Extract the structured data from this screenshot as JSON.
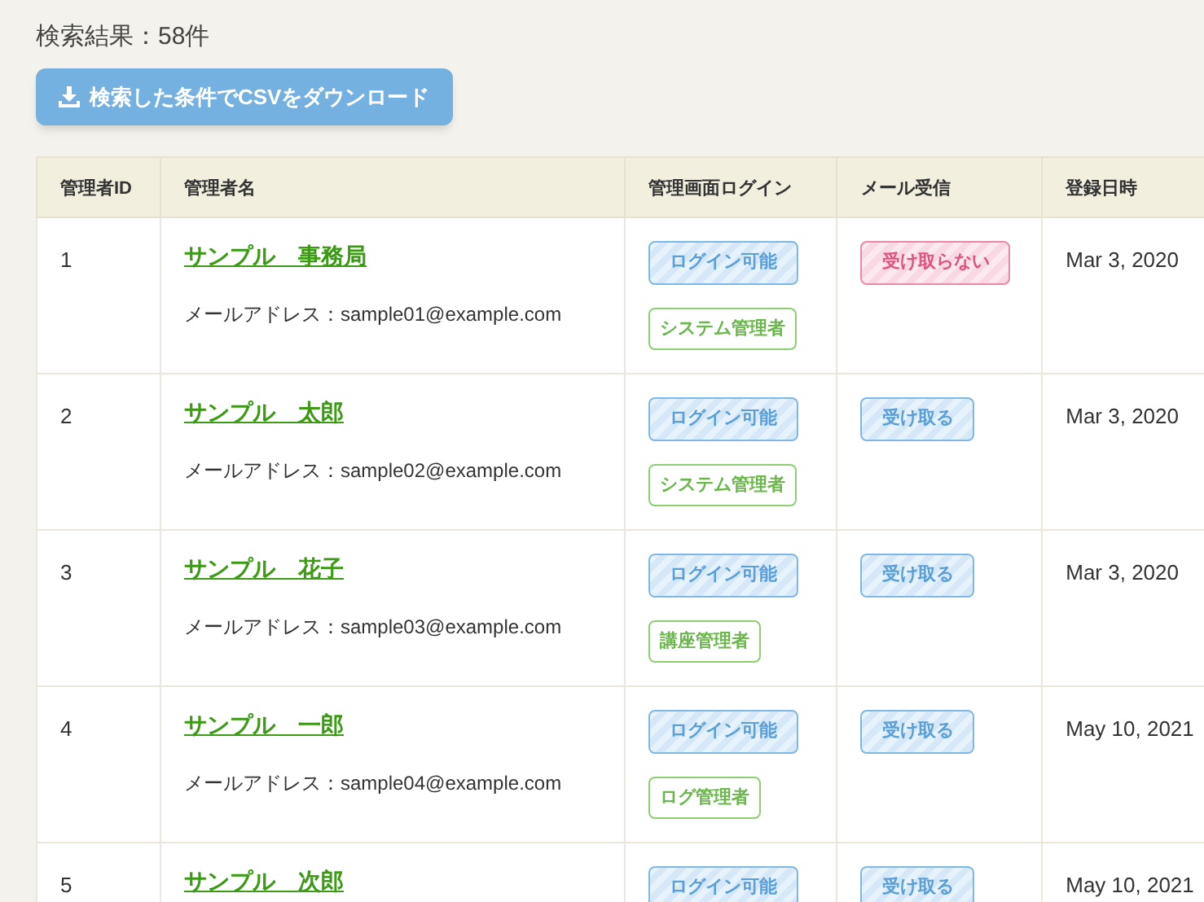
{
  "result_count": "検索結果：58件",
  "download_button": "検索した条件でCSVをダウンロード",
  "table": {
    "columns": [
      "管理者ID",
      "管理者名",
      "管理画面ログイン",
      "メール受信",
      "登録日時"
    ],
    "rows": [
      {
        "id": "1",
        "name": "サンプル　事務局",
        "email": "メールアドレス：sample01@example.com",
        "login": "ログイン可能",
        "role": "システム管理者",
        "mail": {
          "kind": "decline",
          "label": "受け取らない"
        },
        "date": "Mar 3, 2020"
      },
      {
        "id": "2",
        "name": "サンプル　太郎",
        "email": "メールアドレス：sample02@example.com",
        "login": "ログイン可能",
        "role": "システム管理者",
        "mail": {
          "kind": "accept",
          "label": "受け取る"
        },
        "date": "Mar 3, 2020"
      },
      {
        "id": "3",
        "name": "サンプル　花子",
        "email": "メールアドレス：sample03@example.com",
        "login": "ログイン可能",
        "role": "講座管理者",
        "mail": {
          "kind": "accept",
          "label": "受け取る"
        },
        "date": "Mar 3, 2020"
      },
      {
        "id": "4",
        "name": "サンプル　一郎",
        "email": "メールアドレス：sample04@example.com",
        "login": "ログイン可能",
        "role": "ログ管理者",
        "mail": {
          "kind": "accept",
          "label": "受け取る"
        },
        "date": "May 10, 2021"
      },
      {
        "id": "5",
        "name": "サンプル　次郎",
        "login": "ログイン可能",
        "mail": {
          "kind": "accept",
          "label": "受け取る"
        },
        "date": "May 10, 2021"
      }
    ]
  }
}
